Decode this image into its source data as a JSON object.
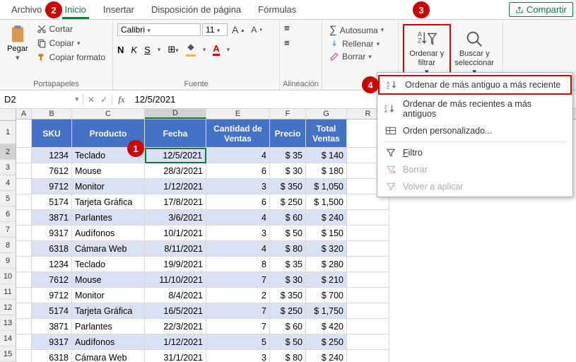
{
  "menu": {
    "archivo": "Archivo",
    "inicio": "Inicio",
    "insertar": "Insertar",
    "disposicion": "Disposición de página",
    "formulas": "Fórmulas",
    "compartir": "Compartir"
  },
  "ribbon": {
    "portapapeles": "Portapapeles",
    "fuente": "Fuente",
    "alineacion": "Alineación",
    "pegar": "Pegar",
    "cortar": "Cortar",
    "copiar": "Copiar",
    "copiarFormato": "Copiar formato",
    "fontName": "Calibri",
    "fontSize": "11",
    "autosuma": "Autosuma",
    "rellenar": "Rellenar",
    "borrar": "Borrar",
    "ordenarFiltrar": "Ordenar y filtrar",
    "buscarSeleccionar": "Buscar y seleccionar"
  },
  "namebox": "D2",
  "formula": "12/5/2021",
  "cols": [
    "A",
    "B",
    "C",
    "D",
    "E",
    "F",
    "G",
    "R"
  ],
  "headers": {
    "sku": "SKU",
    "producto": "Producto",
    "fecha": "Fecha",
    "cantidad": "Cantidad de Ventas",
    "precio": "Precio",
    "total": "Total Ventas"
  },
  "rows": [
    {
      "n": 2,
      "sku": "1234",
      "prod": "Teclado",
      "fecha": "12/5/2021",
      "cant": "4",
      "precio": "$ 35",
      "total": "$ 140"
    },
    {
      "n": 3,
      "sku": "7612",
      "prod": "Mouse",
      "fecha": "28/3/2021",
      "cant": "6",
      "precio": "$ 30",
      "total": "$ 180"
    },
    {
      "n": 4,
      "sku": "9712",
      "prod": "Monitor",
      "fecha": "1/12/2021",
      "cant": "3",
      "precio": "$ 350",
      "total": "$ 1,050"
    },
    {
      "n": 5,
      "sku": "5174",
      "prod": "Tarjeta Gráfica",
      "fecha": "17/8/2021",
      "cant": "6",
      "precio": "$ 250",
      "total": "$ 1,500"
    },
    {
      "n": 6,
      "sku": "3871",
      "prod": "Parlantes",
      "fecha": "3/6/2021",
      "cant": "4",
      "precio": "$ 60",
      "total": "$ 240"
    },
    {
      "n": 7,
      "sku": "9317",
      "prod": "Audífonos",
      "fecha": "10/1/2021",
      "cant": "3",
      "precio": "$ 50",
      "total": "$ 150"
    },
    {
      "n": 8,
      "sku": "6318",
      "prod": "Cámara Web",
      "fecha": "8/11/2021",
      "cant": "4",
      "precio": "$ 80",
      "total": "$ 320"
    },
    {
      "n": 9,
      "sku": "1234",
      "prod": "Teclado",
      "fecha": "19/9/2021",
      "cant": "8",
      "precio": "$ 35",
      "total": "$ 280"
    },
    {
      "n": 10,
      "sku": "7612",
      "prod": "Mouse",
      "fecha": "11/10/2021",
      "cant": "7",
      "precio": "$ 30",
      "total": "$ 210"
    },
    {
      "n": 11,
      "sku": "9712",
      "prod": "Monitor",
      "fecha": "8/4/2021",
      "cant": "2",
      "precio": "$ 350",
      "total": "$ 700"
    },
    {
      "n": 12,
      "sku": "5174",
      "prod": "Tarjeta Gráfica",
      "fecha": "16/5/2021",
      "cant": "7",
      "precio": "$ 250",
      "total": "$ 1,750"
    },
    {
      "n": 13,
      "sku": "3871",
      "prod": "Parlantes",
      "fecha": "22/3/2021",
      "cant": "7",
      "precio": "$ 60",
      "total": "$ 420"
    },
    {
      "n": 14,
      "sku": "9317",
      "prod": "Audífonos",
      "fecha": "1/12/2021",
      "cant": "5",
      "precio": "$ 50",
      "total": "$ 250"
    },
    {
      "n": 15,
      "sku": "6318",
      "prod": "Cámara Web",
      "fecha": "31/1/2021",
      "cant": "3",
      "precio": "$ 80",
      "total": "$ 240"
    }
  ],
  "sortmenu": {
    "oldest": "Ordenar de más antiguo a más reciente",
    "newest": "Ordenar de más recientes a más antiguos",
    "custom": "Orden personalizado...",
    "filter": "Filtro",
    "clear": "Borrar",
    "reapply": "Volver a aplicar"
  },
  "annotations": {
    "b1": "1",
    "b2": "2",
    "b3": "3",
    "b4": "4"
  }
}
